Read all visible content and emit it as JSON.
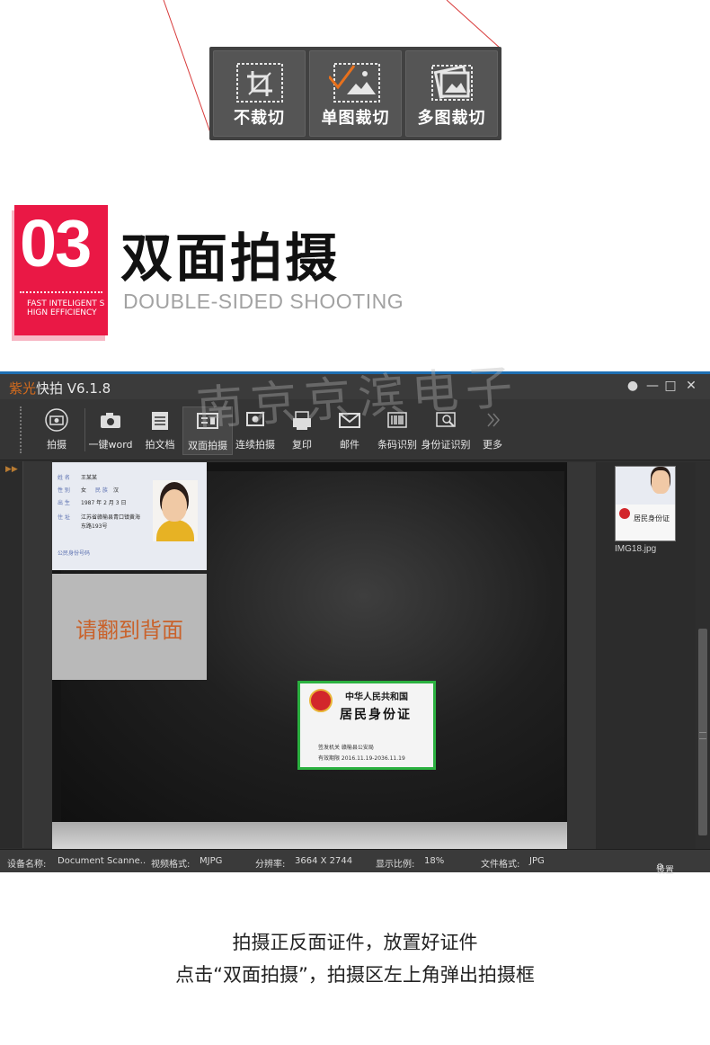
{
  "crop_panel": {
    "buttons": [
      {
        "label": "不裁切",
        "icon": "no-crop-icon"
      },
      {
        "label": "单图裁切",
        "icon": "single-crop-icon"
      },
      {
        "label": "多图裁切",
        "icon": "multi-crop-icon"
      }
    ]
  },
  "section": {
    "number": "03",
    "tagline_line1": "FAST INTELIGENT S",
    "tagline_line2": "HIGN EFFICIENCY",
    "title": "双面拍摄",
    "subtitle": "DOUBLE-SIDED SHOOTING",
    "accent": "#ea1845"
  },
  "app": {
    "brand_a": "紫光",
    "brand_b": "快拍 V6.1.8",
    "toolbar": [
      {
        "label": "拍摄",
        "icon": "camera-circle-icon"
      },
      {
        "label": "一键word",
        "icon": "camera-icon"
      },
      {
        "label": "拍文档",
        "icon": "document-icon"
      },
      {
        "label": "双面拍摄",
        "icon": "id-card-icon"
      },
      {
        "label": "连续拍摄",
        "icon": "burst-camera-icon"
      },
      {
        "label": "复印",
        "icon": "copy-icon"
      },
      {
        "label": "邮件",
        "icon": "mail-icon"
      },
      {
        "label": "条码识别",
        "icon": "barcode-icon"
      },
      {
        "label": "身份证识别",
        "icon": "id-scan-icon"
      },
      {
        "label": "更多",
        "icon": "more-icon"
      }
    ],
    "capture_prompt": "请翻到背面",
    "id_front": {
      "name_label": "姓 名",
      "name": "王某某",
      "gender_label": "性 别",
      "gender": "女",
      "ethnic_label": "民 族",
      "ethnic": "汉",
      "birth_label": "出 生",
      "birth": "1987 年 2 月 3 日",
      "addr_label": "住 址",
      "addr_line1": "江苏省赣榆县青口镇黄海",
      "addr_line2": "东路193号",
      "idno_label": "公民身份号码"
    },
    "id_back": {
      "line1": "中华人民共和国",
      "line2": "居民身份证",
      "authority": "签发机关   赣榆县公安局",
      "validity": "有效期限   2016.11.19-2036.11.19"
    },
    "thumbnail": {
      "filename": "IMG18.jpg",
      "back_text": "居民身份证"
    },
    "status": {
      "device_label": "设备名称:",
      "device": "Document Scanne..",
      "format_label": "视频格式:",
      "format": "MJPG",
      "resolution_label": "分辨率:",
      "resolution": "3664 X 2744",
      "scale_label": "显示比例:",
      "scale": "18%",
      "file_label": "文件格式:",
      "file_format": "JPG",
      "settings": "设置"
    },
    "watermark": "南京京滨电子"
  },
  "caption": {
    "line1": "拍摄正反面证件，放置好证件",
    "line2": "点击“双面拍摄”，拍摄区左上角弹出拍摄框"
  }
}
